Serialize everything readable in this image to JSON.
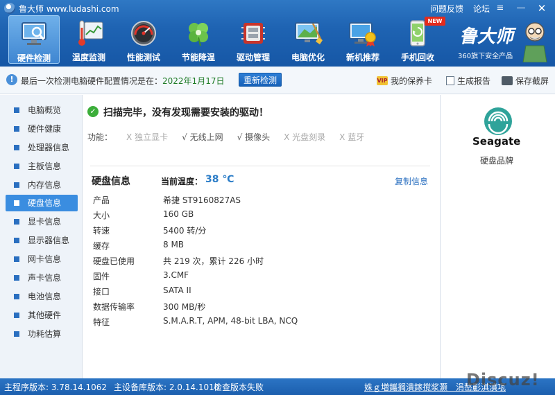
{
  "app": {
    "title": "鲁大师 www.ludashi.com",
    "links": [
      "问题反馈",
      "论坛"
    ]
  },
  "toolbar": {
    "items": [
      {
        "label": "硬件检测",
        "icon": "monitor-magnifier-icon",
        "active": true
      },
      {
        "label": "温度监测",
        "icon": "thermometer-icon",
        "active": false
      },
      {
        "label": "性能测试",
        "icon": "speedometer-icon",
        "active": false
      },
      {
        "label": "节能降温",
        "icon": "clover-icon",
        "active": false
      },
      {
        "label": "驱动管理",
        "icon": "chip-icon",
        "active": false
      },
      {
        "label": "电脑优化",
        "icon": "monitor-broom-icon",
        "active": false
      },
      {
        "label": "新机推荐",
        "icon": "monitor-medal-icon",
        "active": false
      },
      {
        "label": "手机回收",
        "icon": "phone-recycle-icon",
        "active": false
      }
    ],
    "new_badge": "NEW"
  },
  "brand": {
    "name": "鲁大师",
    "subtitle": "360旗下安全产品"
  },
  "status": {
    "text": "最后一次检测电脑硬件配置情况是在：",
    "date": "2022年1月17日",
    "recheck": "重新检测",
    "actions": [
      "我的保养卡",
      "生成报告",
      "保存截屏"
    ],
    "vip_badge": "VIP"
  },
  "sidebar": {
    "items": [
      "电脑概览",
      "硬件健康",
      "处理器信息",
      "主板信息",
      "内存信息",
      "硬盘信息",
      "显卡信息",
      "显示器信息",
      "网卡信息",
      "声卡信息",
      "电池信息",
      "其他硬件",
      "功耗估算"
    ],
    "active_index": 5
  },
  "main": {
    "scan_message": "扫描完毕，没有发现需要安装的驱动！",
    "features_label": "功能：",
    "features": [
      {
        "mark": "X",
        "name": "独立显卡",
        "supported": false
      },
      {
        "mark": "√",
        "name": "无线上网",
        "supported": true
      },
      {
        "mark": "√",
        "name": "摄像头",
        "supported": true
      },
      {
        "mark": "X",
        "name": "光盘刻录",
        "supported": false
      },
      {
        "mark": "X",
        "name": "蓝牙",
        "supported": false
      }
    ],
    "section_title": "硬盘信息",
    "temp_label": "当前温度：",
    "temp_value": "38 ℃",
    "copy_label": "复制信息",
    "specs": [
      {
        "k": "产品",
        "v": "希捷 ST9160827AS"
      },
      {
        "k": "大小",
        "v": "160 GB"
      },
      {
        "k": "转速",
        "v": "5400 转/分"
      },
      {
        "k": "缓存",
        "v": "8 MB"
      },
      {
        "k": "硬盘已使用",
        "v": "共 219 次，累计 226 小时"
      },
      {
        "k": "固件",
        "v": "3.CMF"
      },
      {
        "k": "接口",
        "v": "SATA II"
      },
      {
        "k": "数据传输率",
        "v": "300 MB/秒"
      },
      {
        "k": "特征",
        "v": "S.M.A.R.T,  APM,  48-bit LBA,  NCQ"
      }
    ]
  },
  "right_panel": {
    "brand_word": "Seagate",
    "caption": "硬盘品牌"
  },
  "footer": {
    "main_version": "主程序版本: 3.78.14.1062",
    "db_version": "主设备库版本: 2.0.14.1010",
    "check_status": "检查版本失败",
    "scroll_text": "姝ｇ増鑴搁潰鎵撹浆灏　涓嶅彲淇濆瓨",
    "watermark": "Discuz!"
  },
  "colors": {
    "header": "#1f64b3",
    "accent": "#3a8de0",
    "date_green": "#1e7b26",
    "temp_blue": "#2a7cc7"
  }
}
